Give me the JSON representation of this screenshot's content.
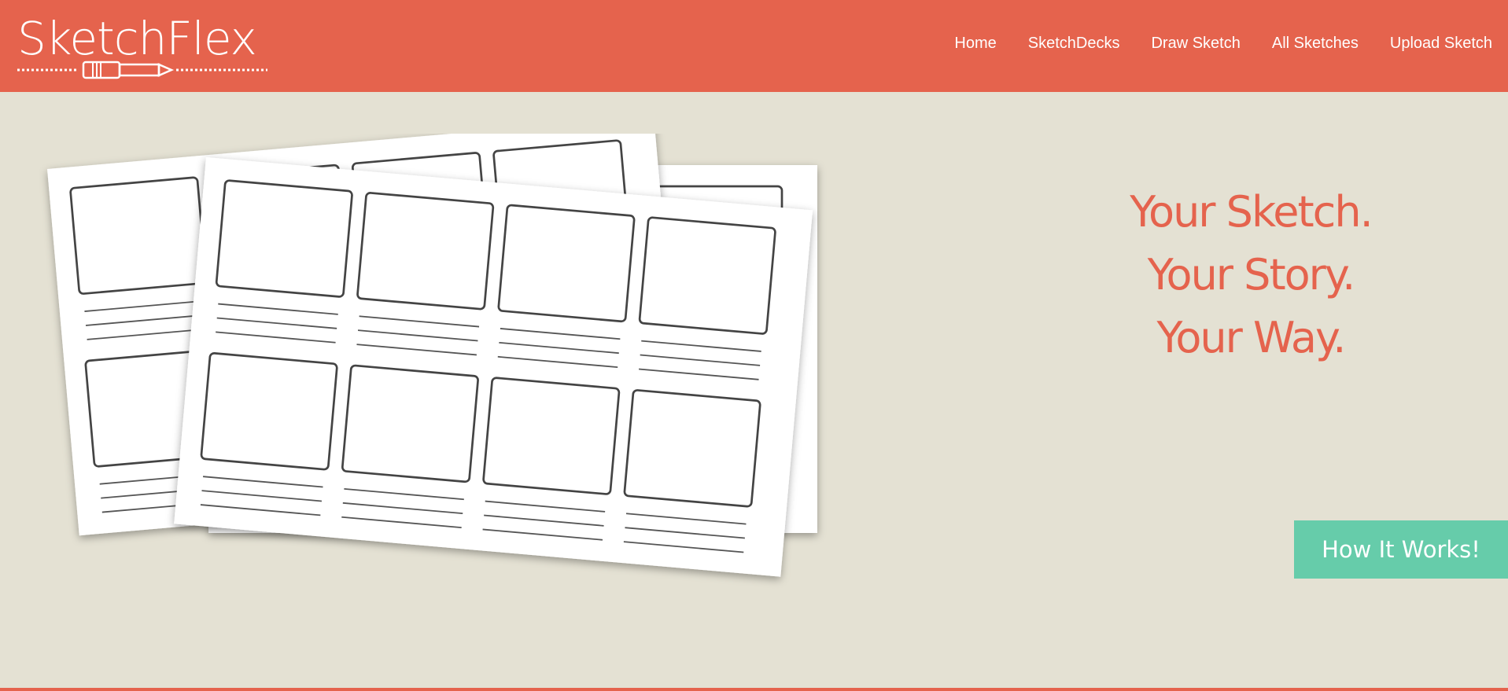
{
  "brand": {
    "name": "SketchFlex"
  },
  "nav": {
    "items": [
      {
        "label": "Home"
      },
      {
        "label": "SketchDecks"
      },
      {
        "label": "Draw Sketch"
      },
      {
        "label": "All Sketches"
      },
      {
        "label": "Upload Sketch"
      }
    ]
  },
  "hero": {
    "tagline": [
      "Your Sketch.",
      "Your Story.",
      "Your Way."
    ],
    "cta_label": "How It Works!",
    "image_icon": "storyboard-sheets-illustration"
  },
  "colors": {
    "accent": "#e5634d",
    "background": "#e4e1d3",
    "cta": "#66ccaa"
  }
}
